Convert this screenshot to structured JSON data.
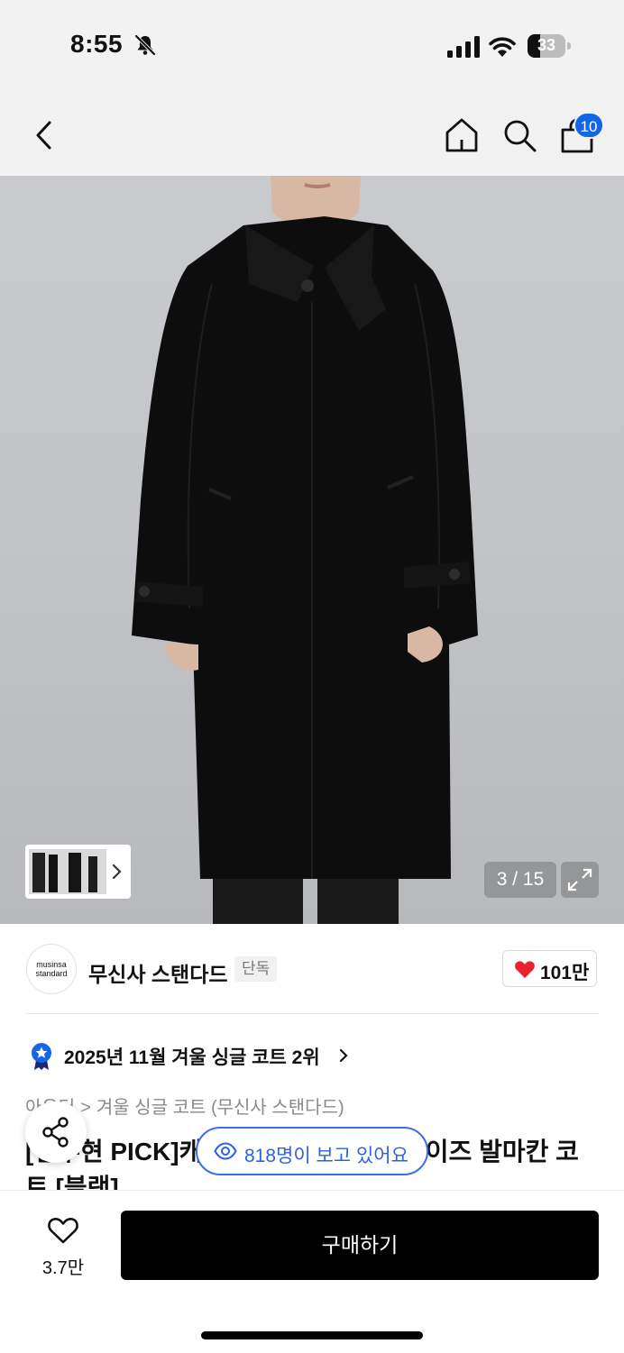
{
  "status_bar": {
    "time": "8:55",
    "battery": "33"
  },
  "nav": {
    "cart_count": "10"
  },
  "gallery": {
    "counter": "3 / 15"
  },
  "brand": {
    "logo_line1": "musinsa",
    "logo_line2": "standard",
    "name": "무신사 스탠다드",
    "tag": "단독",
    "likes": "101만"
  },
  "ranking": {
    "text": "2025년 11월 겨울 싱글 코트 2위"
  },
  "breadcrumb": {
    "level1": "아우터",
    "separator": ">",
    "level2": "겨울 싱글 코트 (무신사 스탠다드)"
  },
  "product": {
    "title": "[변우현 PICK]캐시미어 블렌드 오버사이즈 발마칸 코트 [블랙]"
  },
  "viewers": {
    "text": "818명이 보고 있어요"
  },
  "bottom_bar": {
    "wish_count": "3.7만",
    "buy_label": "구매하기"
  },
  "colors": {
    "accent_blue": "#1565e8",
    "heart_red": "#e8232e",
    "buy_button": "#000000"
  }
}
